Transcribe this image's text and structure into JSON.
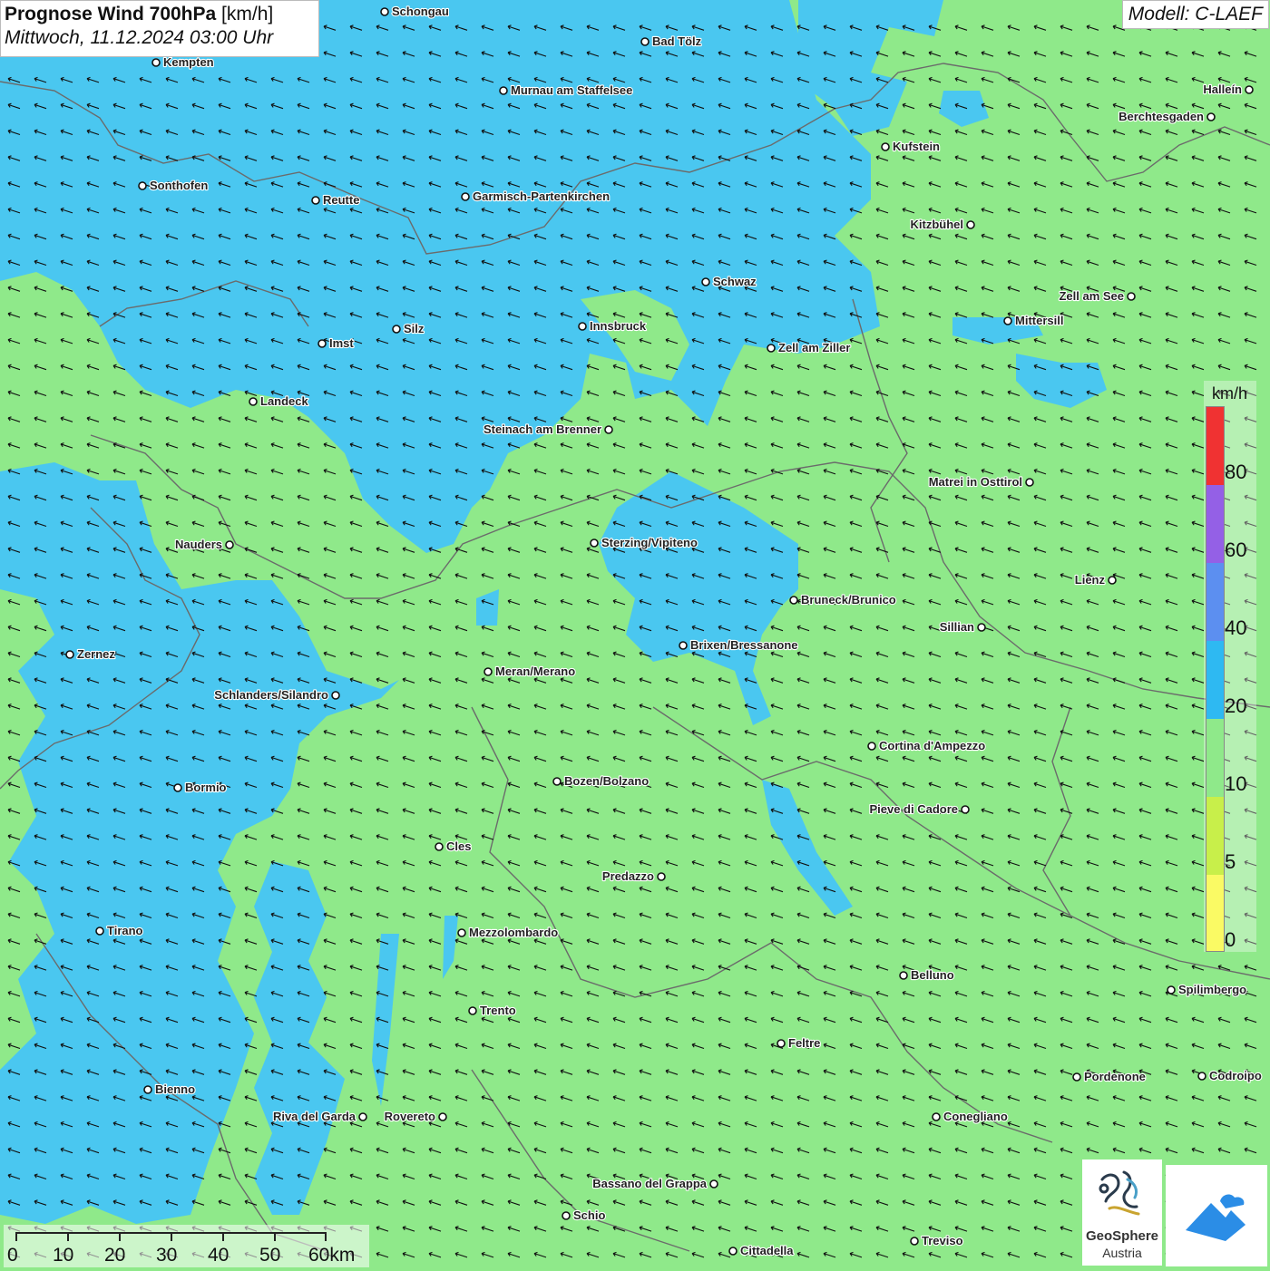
{
  "title": {
    "main_bold": "Prognose Wind 700hPa",
    "unit": " [km/h]",
    "datetime": "Mittwoch, 11.12.2024 03:00 Uhr"
  },
  "model": "Modell: C-LAEF",
  "legend": {
    "unit": "km/h",
    "labels": [
      "80",
      "60",
      "40",
      "20",
      "10",
      "5",
      "0"
    ],
    "colors": [
      "#f03232",
      "#9460e6",
      "#5c8ff0",
      "#2eb9f2",
      "#8fe98a",
      "#c8ef4a",
      "#fafa64"
    ]
  },
  "scale": {
    "labels": [
      "0",
      "10",
      "20",
      "30",
      "40",
      "50",
      "60km"
    ]
  },
  "colors": {
    "wind_10_20": "#8fe98a",
    "wind_20_40": "#4ac7f0",
    "border": "#6b6b6b"
  },
  "cities": [
    "Schongau",
    "Kempten",
    "Bad Tölz",
    "Murnau am Staffelsee",
    "Halleín",
    "Berchtesgaden",
    "Kufstein",
    "Sonthofen",
    "Reutte",
    "Garmisch-Partenkirchen",
    "Kitzbühel",
    "Schwaz",
    "Zell am See",
    "Innsbruck",
    "Silz",
    "Mittersill",
    "Imst",
    "Zell am Ziller",
    "Landeck",
    "Steinach am Brenner",
    "Matrei in Osttirol",
    "Nauders",
    "Sterzing/Vipiteno",
    "Lienz",
    "Bruneck/Brunico",
    "Sillian",
    "Zernez",
    "Brixen/Bressanone",
    "Meran/Merano",
    "Schlanders/Silandro",
    "Cortina d'Ampezzo",
    "Bozen/Bolzano",
    "Bormio",
    "Pieve di Cadore",
    "Cles",
    "Predazzo",
    "Tirano",
    "Mezzolombardo",
    "Belluno",
    "Spilimbergo",
    "Trento",
    "Feltre",
    "Pordenone",
    "Codroipo",
    "Bienno",
    "Riva del Garda",
    "Rovereto",
    "Conegliano",
    "Bassano del Grappa",
    "Schio",
    "Treviso",
    "Cittadella"
  ],
  "logos": {
    "geosphere_line1": "GeoSphere",
    "geosphere_line2": "Austria"
  }
}
